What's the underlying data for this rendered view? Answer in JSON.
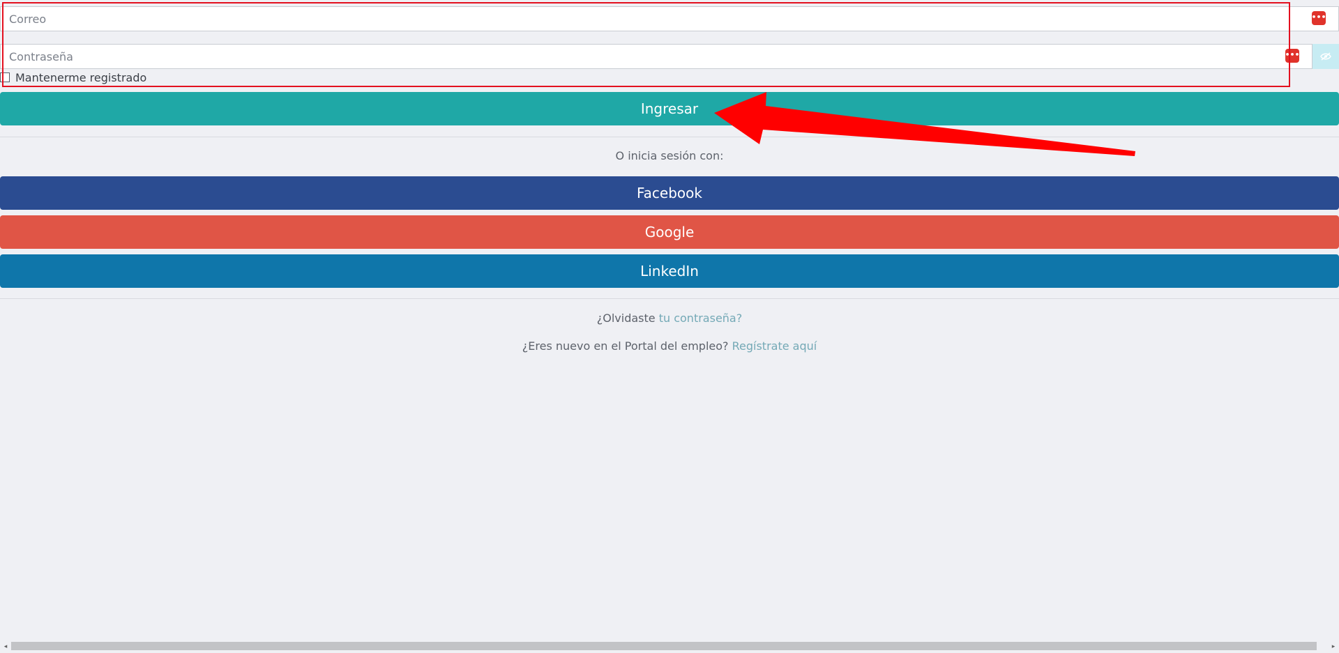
{
  "form": {
    "email_placeholder": "Correo",
    "password_placeholder": "Contraseña",
    "remember_label": "Mantenerme registrado",
    "login_label": "Ingresar"
  },
  "social": {
    "intro": "O inicia sesión con:",
    "facebook_label": "Facebook",
    "google_label": "Google",
    "linkedin_label": "LinkedIn"
  },
  "links": {
    "forgot_prefix": "¿Olvidaste ",
    "forgot_link": "tu contraseña?",
    "register_prefix": "¿Eres nuevo en el Portal del empleo? ",
    "register_link": "Regístrate aquí"
  },
  "colors": {
    "login": "#1fa8a6",
    "facebook": "#2b4c91",
    "google": "#e05546",
    "linkedin": "#0f76aa",
    "annotation": "#ff0000"
  },
  "icons": {
    "password_manager": "password-manager-icon",
    "visibility_toggle": "eye-slash-icon"
  }
}
